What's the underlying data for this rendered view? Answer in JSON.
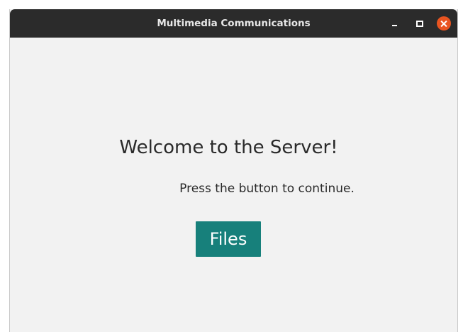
{
  "window": {
    "title": "Multimedia Communications",
    "controls": {
      "minimize": "minimize-icon",
      "maximize": "maximize-icon",
      "close": "close-icon"
    },
    "close_color": "#e95420",
    "titlebar_color": "#2b2b2b"
  },
  "main": {
    "heading": "Welcome to the Server!",
    "subtext": "Press the button to continue.",
    "button_label": "Files",
    "button_color": "#17807b"
  }
}
